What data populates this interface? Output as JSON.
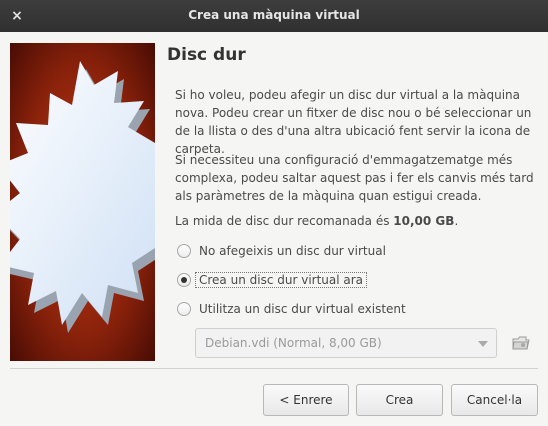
{
  "window": {
    "title": "Crea una màquina virtual",
    "close_glyph": "×"
  },
  "page": {
    "heading": "Disc dur",
    "para1": "Si ho voleu, podeu afegir un disc dur virtual a la màquina nova. Podeu crear un fitxer de disc nou o bé seleccionar un de la llista o des d'una altra ubicació fent servir la icona de carpeta.",
    "para2": "Si necessiteu una configuració d'emmagatzematge més complexa, podeu saltar aquest pas i fer els canvis més tard als paràmetres de la màquina quan estigui creada.",
    "recommend_prefix": "La mida de disc dur recomanada és ",
    "recommend_value": "10,00 GB",
    "recommend_suffix": "."
  },
  "options": [
    {
      "label": "No afegeixis un disc dur virtual",
      "checked": false
    },
    {
      "label": "Crea un disc dur virtual ara",
      "checked": true
    },
    {
      "label": "Utilitza un disc dur virtual existent",
      "checked": false
    }
  ],
  "disk_select": {
    "value": "Debian.vdi (Normal, 8,00 GB)",
    "enabled": false
  },
  "buttons": {
    "back": "< Enrere",
    "create": "Crea",
    "cancel": "Cancel·la"
  },
  "icons": {
    "close": "close-icon",
    "folder": "folder-icon",
    "combo_arrow": "chevron-down-icon"
  },
  "colors": {
    "titlebar": "#333333",
    "art_bg": "#7a1a0a",
    "art_star": "#eaf3ff"
  }
}
